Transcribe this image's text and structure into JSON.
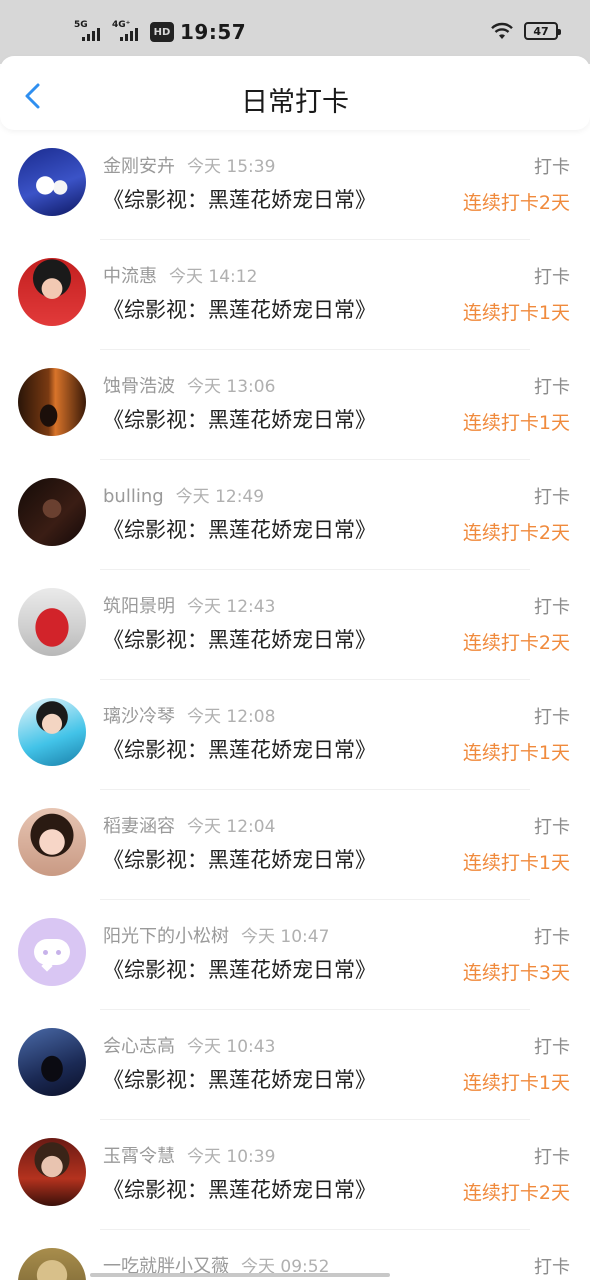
{
  "status_bar": {
    "signal_1_label": "5G",
    "signal_2_label": "4G⁺",
    "hd_label": "HD",
    "time": "19:57",
    "battery": "47"
  },
  "header": {
    "title": "日常打卡",
    "back_icon": "chevron-left-icon",
    "accent_color": "#2f8ff0"
  },
  "colors": {
    "streak": "#f08a3c",
    "meta": "#9a9a9a"
  },
  "entries": [
    {
      "name": "金刚安卉",
      "time": "今天 15:39",
      "book": "《综影视：黑莲花娇宠日常》",
      "tag": "打卡",
      "streak": "连续打卡2天"
    },
    {
      "name": "中流惠",
      "time": "今天 14:12",
      "book": "《综影视：黑莲花娇宠日常》",
      "tag": "打卡",
      "streak": "连续打卡1天"
    },
    {
      "name": "蚀骨浩波",
      "time": "今天 13:06",
      "book": "《综影视：黑莲花娇宠日常》",
      "tag": "打卡",
      "streak": "连续打卡1天"
    },
    {
      "name": "bulling",
      "time": "今天 12:49",
      "book": "《综影视：黑莲花娇宠日常》",
      "tag": "打卡",
      "streak": "连续打卡2天"
    },
    {
      "name": "筑阳景明",
      "time": "今天 12:43",
      "book": "《综影视：黑莲花娇宠日常》",
      "tag": "打卡",
      "streak": "连续打卡2天"
    },
    {
      "name": "璃沙冷琴",
      "time": "今天 12:08",
      "book": "《综影视：黑莲花娇宠日常》",
      "tag": "打卡",
      "streak": "连续打卡1天"
    },
    {
      "name": "稻妻涵容",
      "time": "今天 12:04",
      "book": "《综影视：黑莲花娇宠日常》",
      "tag": "打卡",
      "streak": "连续打卡1天"
    },
    {
      "name": "阳光下的小松树",
      "time": "今天 10:47",
      "book": "《综影视：黑莲花娇宠日常》",
      "tag": "打卡",
      "streak": "连续打卡3天"
    },
    {
      "name": "会心志高",
      "time": "今天 10:43",
      "book": "《综影视：黑莲花娇宠日常》",
      "tag": "打卡",
      "streak": "连续打卡1天"
    },
    {
      "name": "玉霄令慧",
      "time": "今天 10:39",
      "book": "《综影视：黑莲花娇宠日常》",
      "tag": "打卡",
      "streak": "连续打卡2天"
    },
    {
      "name": "一吃就胖小又薇",
      "time": "今天 09:52",
      "book": "",
      "tag": "打卡",
      "streak": ""
    }
  ]
}
